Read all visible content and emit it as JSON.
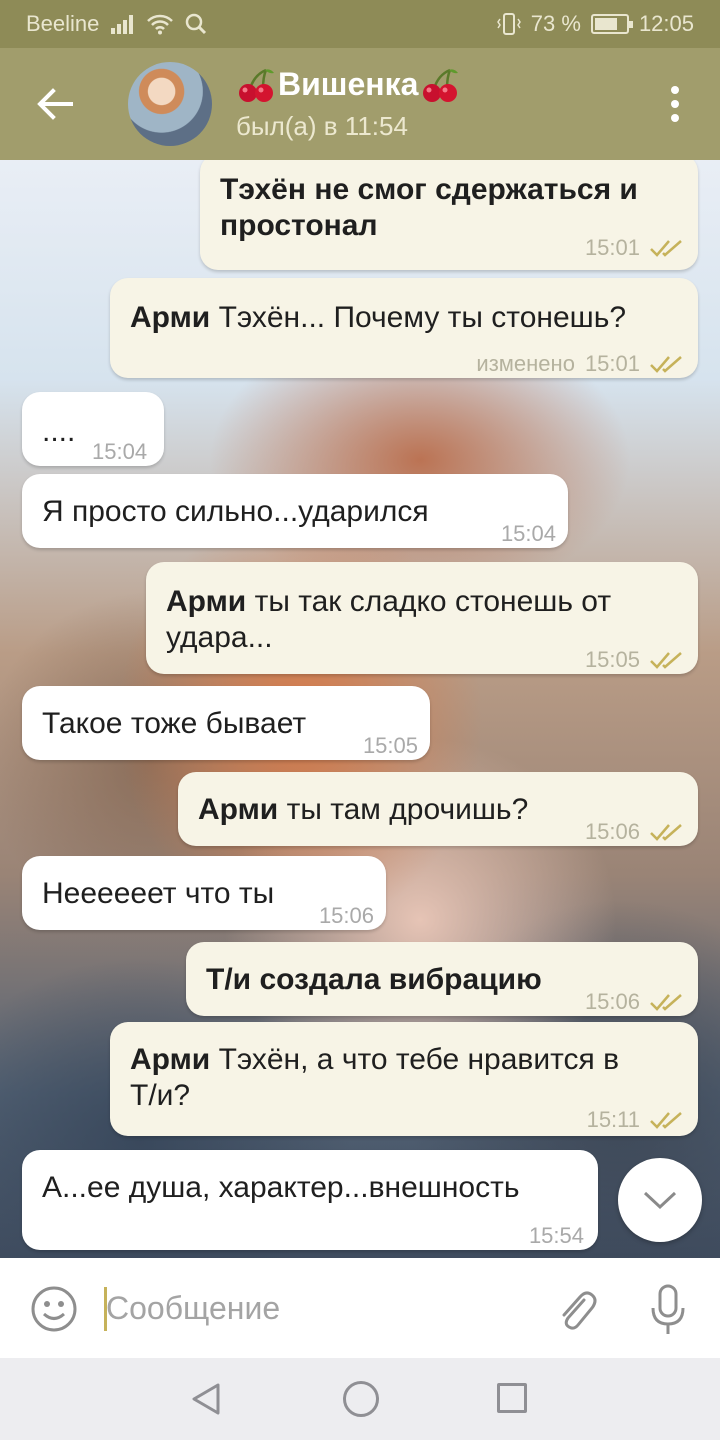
{
  "status_bar": {
    "carrier": "Beeline",
    "battery": "73 %",
    "battery_level": 0.73,
    "time": "12:05"
  },
  "header": {
    "title": "Вишенка",
    "title_emoji": "cherry-icon",
    "subtitle": "был(а) в 11:54"
  },
  "messages": [
    {
      "direction": "out",
      "sender": "",
      "text": "Тэхён не смог сдержаться и",
      "text2": "простонал",
      "time": "15:01",
      "status": "read"
    },
    {
      "direction": "out",
      "sender": "Арми",
      "text": "Тэхён... Почему ты стонешь?",
      "edited": "изменено",
      "time": "15:01",
      "status": "read"
    },
    {
      "direction": "in",
      "text": "....",
      "time": "15:04"
    },
    {
      "direction": "in",
      "text": "Я просто сильно...ударился",
      "time": "15:04"
    },
    {
      "direction": "out",
      "sender": "Арми",
      "text": "ты так сладко стонешь от",
      "text2": "удара...",
      "time": "15:05",
      "status": "read"
    },
    {
      "direction": "in",
      "text": "Такое тоже бывает",
      "time": "15:05"
    },
    {
      "direction": "out",
      "sender": "Арми",
      "text": "ты там дрочишь?",
      "time": "15:06",
      "status": "read"
    },
    {
      "direction": "in",
      "text": "Неееееет что ты",
      "time": "15:06"
    },
    {
      "direction": "out",
      "sender": "",
      "text": "Т/и создала вибрацию",
      "time": "15:06",
      "status": "read"
    },
    {
      "direction": "out",
      "sender": "Арми",
      "text": "Тэхён, а что тебе нравится в",
      "text2": "Т/и?",
      "time": "15:11",
      "status": "read"
    },
    {
      "direction": "in",
      "text": "А...ее душа, характер...внешность",
      "time": "15:54"
    }
  ],
  "input": {
    "placeholder": "Сообщение"
  },
  "colors": {
    "status_bar": "#8e8b57",
    "toolbar": "#a19d6c",
    "outgoing_bubble": "#f7f4e6",
    "incoming_bubble": "#ffffff",
    "read_ticks": "#c6b25a"
  }
}
